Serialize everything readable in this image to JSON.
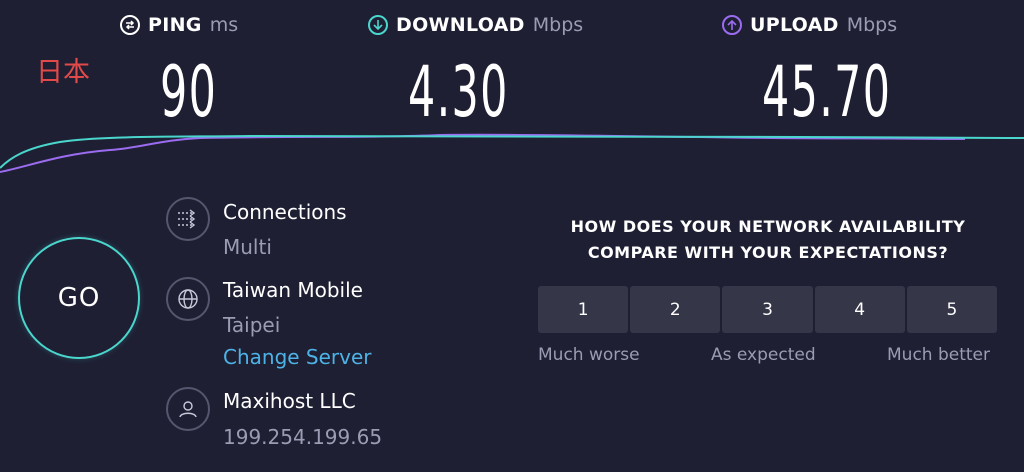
{
  "metrics": {
    "ping": {
      "label": "PING",
      "unit": "ms",
      "value": "90"
    },
    "download": {
      "label": "DOWNLOAD",
      "unit": "Mbps",
      "value": "4.30"
    },
    "upload": {
      "label": "UPLOAD",
      "unit": "Mbps",
      "value": "45.70"
    }
  },
  "region_label": "日本",
  "go_label": "GO",
  "connections": {
    "label": "Connections",
    "value": "Multi"
  },
  "server": {
    "name": "Taiwan Mobile",
    "location": "Taipei",
    "change_link": "Change Server"
  },
  "provider": {
    "name": "Maxihost LLC",
    "ip": "199.254.199.65"
  },
  "survey": {
    "question_line1": "HOW DOES YOUR NETWORK AVAILABILITY",
    "question_line2": "COMPARE WITH YOUR EXPECTATIONS?",
    "options": [
      "1",
      "2",
      "3",
      "4",
      "5"
    ],
    "label_low": "Much worse",
    "label_mid": "As expected",
    "label_high": "Much better"
  },
  "colors": {
    "background": "#1e1f33",
    "download_accent": "#4ad6cc",
    "upload_accent": "#9b6cf0",
    "ping_accent": "#ffffff",
    "region_label": "#e24a4a",
    "link": "#4db3e6"
  },
  "icons": {
    "ping": "ping-icon",
    "download": "download-arrow-icon",
    "upload": "upload-arrow-icon",
    "connections": "connections-icon",
    "server": "globe-icon",
    "provider": "person-icon"
  }
}
